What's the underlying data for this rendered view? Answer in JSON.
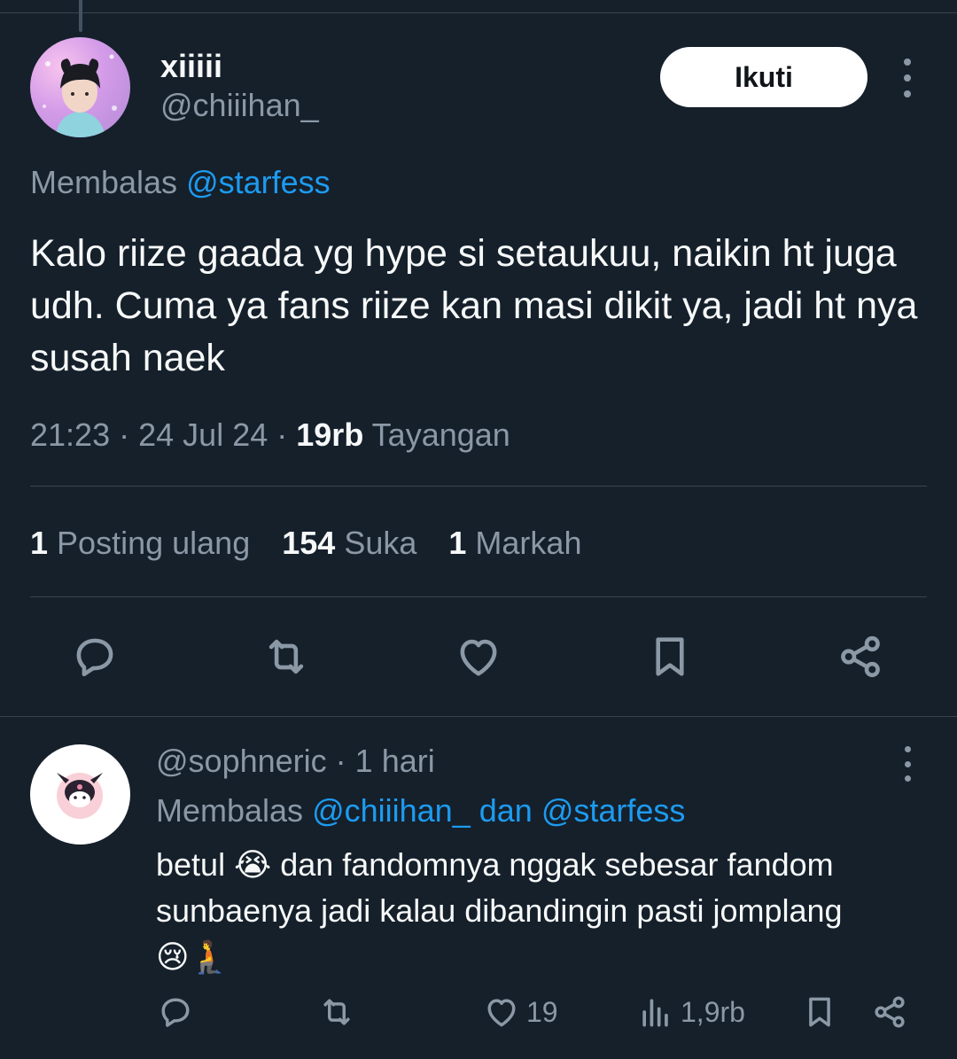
{
  "main_tweet": {
    "display_name": "xiiiii",
    "handle": "@chiiihan_",
    "follow_label": "Ikuti",
    "reply_prefix": "Membalas",
    "reply_to": "@starfess",
    "text": "Kalo riize gaada yg hype si setaukuu, naikin ht juga udh. Cuma ya fans riize kan masi dikit ya, jadi ht nya susah naek",
    "time": "21:23",
    "date": "24 Jul 24",
    "views_count": "19rb",
    "views_label": "Tayangan",
    "reposts_count": "1",
    "reposts_label": "Posting ulang",
    "likes_count": "154",
    "likes_label": "Suka",
    "bookmarks_count": "1",
    "bookmarks_label": "Markah"
  },
  "reply_tweet": {
    "handle": "@sophneric",
    "age": "1 hari",
    "reply_prefix": "Membalas",
    "reply_to_1": "@chiiihan_",
    "reply_connector": "dan",
    "reply_to_2": "@starfess",
    "text_part1": "betul",
    "emoji1": "😭",
    "text_part2": "dan fandomnya nggak sebesar fandom sunbaenya jadi kalau dibandingin pasti jomplang",
    "emoji2": "😢🧎",
    "likes": "19",
    "views": "1,9rb"
  },
  "icons": [
    "reply-icon",
    "repost-icon",
    "like-icon",
    "bookmark-icon",
    "share-icon",
    "views-icon",
    "more-icon"
  ],
  "colors": {
    "background": "#15202b",
    "link": "#1d9bf0",
    "muted": "#8b98a5",
    "text": "#f7f9f9"
  }
}
